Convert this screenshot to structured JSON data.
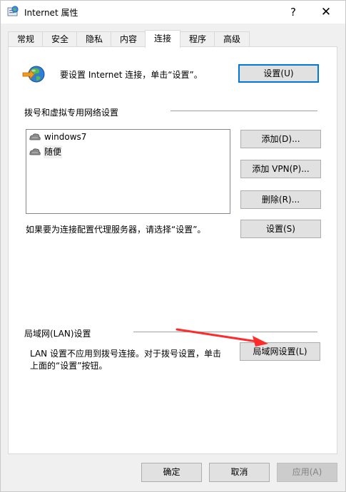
{
  "window": {
    "title": "Internet 属性",
    "help_glyph": "?",
    "close_glyph": "✕"
  },
  "tabs": [
    "常规",
    "安全",
    "隐私",
    "内容",
    "连接",
    "程序",
    "高级"
  ],
  "active_tab": "连接",
  "setup": {
    "text": "要设置 Internet 连接，单击“设置”。",
    "button": "设置(U)"
  },
  "dialup": {
    "group_title": "拨号和虚拟专用网络设置",
    "items": [
      "windows7",
      "随便"
    ],
    "add_button": "添加(D)...",
    "add_vpn_button": "添加 VPN(P)...",
    "remove_button": "删除(R)...",
    "proxy_text": "如果要为连接配置代理服务器，请选择“设置”。",
    "settings_button": "设置(S)"
  },
  "lan": {
    "group_title": "局域网(LAN)设置",
    "text_line1": "LAN 设置不应用到拨号连接。对于拨号设置，单击",
    "text_line2": "上面的“设置”按钮。",
    "button": "局域网设置(L)"
  },
  "footer": {
    "ok": "确定",
    "cancel": "取消",
    "apply": "应用(A)"
  },
  "colors": {
    "accent": "#0078d7",
    "arrow": "#ff2a2a"
  }
}
